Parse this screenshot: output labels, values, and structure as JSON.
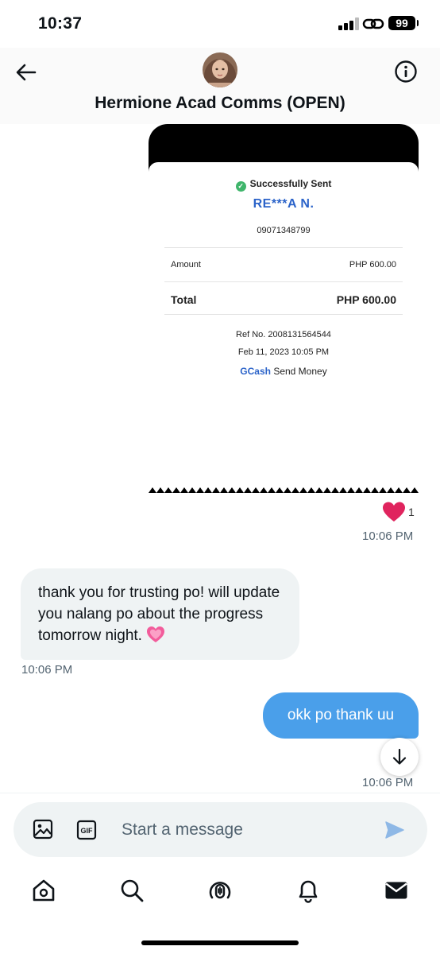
{
  "status_bar": {
    "time": "10:37",
    "battery": "99"
  },
  "header": {
    "title": "Hermione Acad Comms (OPEN)",
    "avatar_icon": "avatar-portrait",
    "back_icon": "arrow-left-icon",
    "info_icon": "info-icon"
  },
  "receipt": {
    "status": "Successfully Sent",
    "recipient": "RE***A N.",
    "number": "09071348799",
    "amount_label": "Amount",
    "amount_value": "PHP 600.00",
    "total_label": "Total",
    "total_value": "PHP 600.00",
    "ref": "Ref No. 2008131564544",
    "date": "Feb 11, 2023 10:05 PM",
    "brand": "GCash",
    "service": "Send Money"
  },
  "reaction": {
    "emoji": "heart",
    "count": "1",
    "color": "#e0245e"
  },
  "messages": [
    {
      "direction": "outgoing",
      "type": "image",
      "time": "10:06 PM"
    },
    {
      "direction": "incoming",
      "text": "thank you for trusting po! will update you nalang po about the progress tomorrow night.",
      "emoji": "growing-heart",
      "time": "10:06 PM"
    },
    {
      "direction": "outgoing",
      "text": "okk po thank uu",
      "time": "10:06 PM"
    }
  ],
  "composer": {
    "placeholder": "Start a message"
  },
  "tabs": [
    "home",
    "search",
    "spaces",
    "notifications",
    "messages"
  ],
  "colors": {
    "accent": "#1d9bf0",
    "outgoing_bubble": "#4a9fea",
    "incoming_bubble": "#eff3f4",
    "muted": "#536471"
  }
}
